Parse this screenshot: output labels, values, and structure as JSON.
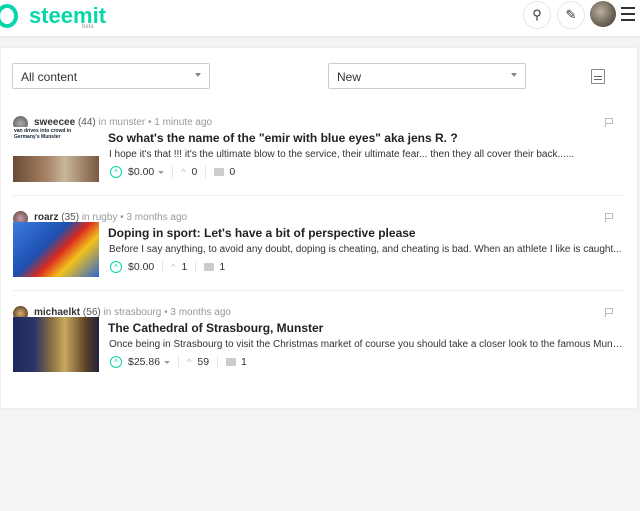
{
  "header": {
    "brand": "steemit",
    "beta": "beta"
  },
  "filters": {
    "content": "All content",
    "sort": "New"
  },
  "posts": [
    {
      "author": "sweecee",
      "rep": "(44)",
      "in": "in",
      "category": "munster",
      "time": "1 minute ago",
      "title": "So what's the name of the \"emir with blue eyes\" aka jens R. ?",
      "body": "I hope it's that !!! it's the ultimate blow to the service, their ultimate fear... then they all cover their back......",
      "payout": "$0.00",
      "votes": "0",
      "comments": "0",
      "thumb_text": "van drives into crowd in Germany's Munster"
    },
    {
      "author": "roarz",
      "rep": "(35)",
      "in": "in",
      "category": "rugby",
      "time": "3 months ago",
      "title": "Doping in sport: Let's have a bit of perspective please",
      "body": "Before I say anything, to avoid any doubt, doping is cheating, and cheating is bad. When an athlete I like is caught...",
      "payout": "$0.00",
      "votes": "1",
      "comments": "1"
    },
    {
      "author": "michaelkt",
      "rep": "(56)",
      "in": "in",
      "category": "strasbourg",
      "time": "3 months ago",
      "title": "The Cathedral of Strasbourg, Munster",
      "body": "Once being in Strasbourg to visit the Christmas market of course you should take a closer look to the famous Munster...",
      "payout": "$25.86",
      "votes": "59",
      "comments": "1"
    }
  ]
}
